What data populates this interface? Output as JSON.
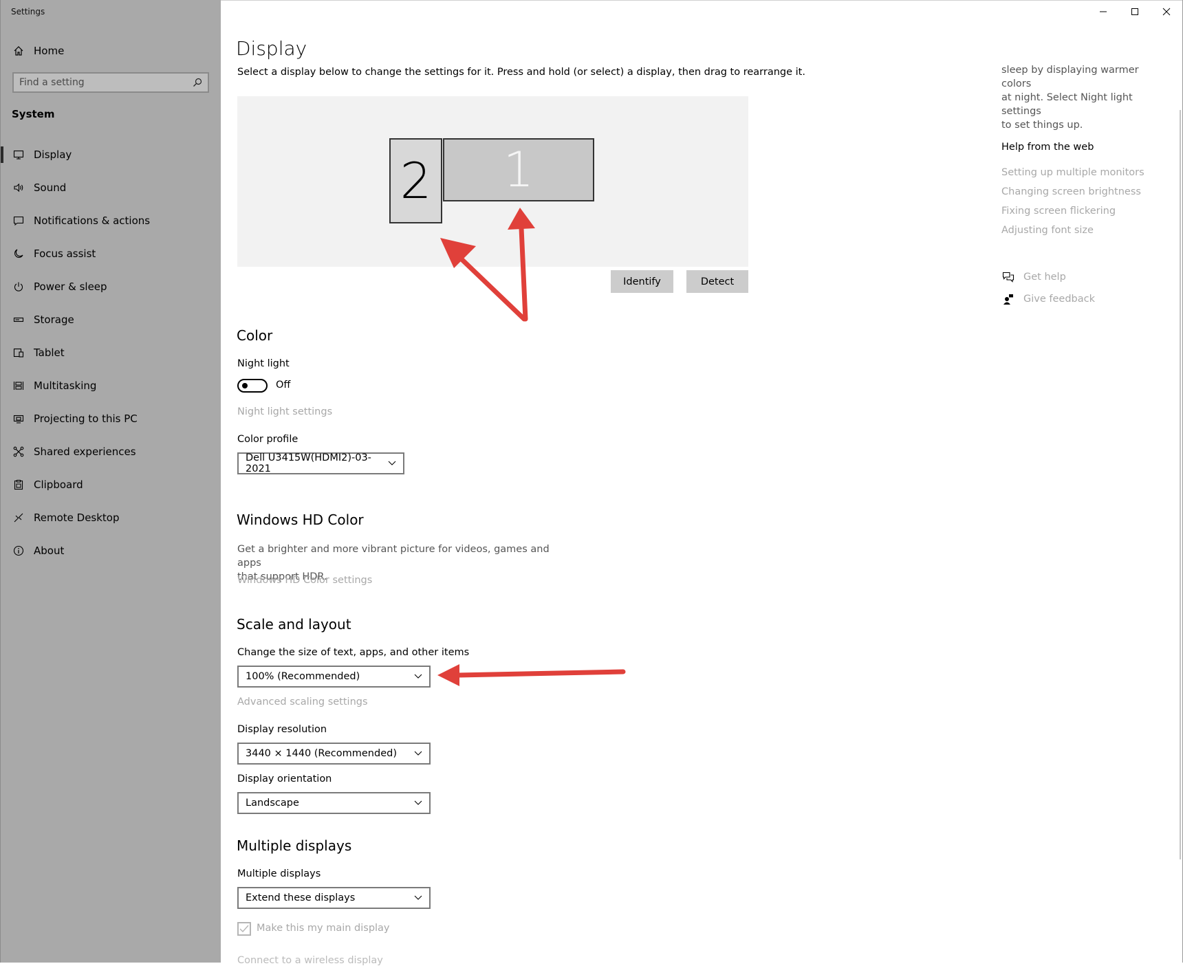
{
  "window": {
    "title": "Settings",
    "minimize_icon": "minimize-icon",
    "maximize_icon": "maximize-icon",
    "close_icon": "close-icon"
  },
  "sidebar": {
    "home_label": "Home",
    "search": {
      "placeholder": "Find a setting",
      "icon": "search-icon"
    },
    "section_label": "System",
    "items": [
      {
        "label": "Display",
        "icon": "monitor-icon",
        "active": true
      },
      {
        "label": "Sound",
        "icon": "speaker-icon"
      },
      {
        "label": "Notifications & actions",
        "icon": "message-icon"
      },
      {
        "label": "Focus assist",
        "icon": "moon-icon"
      },
      {
        "label": "Power & sleep",
        "icon": "power-icon"
      },
      {
        "label": "Storage",
        "icon": "storage-icon"
      },
      {
        "label": "Tablet",
        "icon": "tablet-icon"
      },
      {
        "label": "Multitasking",
        "icon": "multitasking-icon"
      },
      {
        "label": "Projecting to this PC",
        "icon": "projector-icon"
      },
      {
        "label": "Shared experiences",
        "icon": "shared-icon"
      },
      {
        "label": "Clipboard",
        "icon": "clipboard-icon"
      },
      {
        "label": "Remote Desktop",
        "icon": "remote-desktop-icon"
      },
      {
        "label": "About",
        "icon": "info-icon"
      }
    ]
  },
  "main": {
    "title": "Display",
    "intro": "Select a display below to change the settings for it. Press and hold (or select) a display, then drag to rearrange it.",
    "monitors": {
      "display_2": "2",
      "display_1": "1"
    },
    "identify_label": "Identify",
    "detect_label": "Detect",
    "color": {
      "heading": "Color",
      "night_light_label": "Night light",
      "night_light_state": "Off",
      "night_light_settings": "Night light settings",
      "color_profile_label": "Color profile",
      "color_profile_value": "Dell U3415W(HDMI2)-03-2021"
    },
    "hd_color": {
      "heading": "Windows HD Color",
      "description_line1": "Get a brighter and more vibrant picture for videos, games and apps",
      "description_line2": "that support HDR.",
      "settings_link": "Windows HD Color settings"
    },
    "scale_layout": {
      "heading": "Scale and layout",
      "scale_label": "Change the size of text, apps, and other items",
      "scale_value": "100% (Recommended)",
      "advanced_link": "Advanced scaling settings",
      "resolution_label": "Display resolution",
      "resolution_value": "3440 × 1440 (Recommended)",
      "orientation_label": "Display orientation",
      "orientation_value": "Landscape"
    },
    "multiple_displays": {
      "heading": "Multiple displays",
      "label": "Multiple displays",
      "value": "Extend these displays",
      "main_display_checkbox": "Make this my main display",
      "cutoff_link": "Connect to a wireless display"
    }
  },
  "right_panel": {
    "desc_line1": "sleep by displaying warmer colors",
    "desc_line2": "at night. Select Night light settings",
    "desc_line3": "to set things up.",
    "help_heading": "Help from the web",
    "links": [
      "Setting up multiple monitors",
      "Changing screen brightness",
      "Fixing screen flickering",
      "Adjusting font size"
    ],
    "get_help": "Get help",
    "give_feedback": "Give feedback"
  },
  "colors": {
    "sidebar_bg": "#a9a9a9",
    "annotation_arrow": "#e0403a",
    "link_gray": "#a8a8a8",
    "canvas_bg": "#f2f2f2"
  }
}
